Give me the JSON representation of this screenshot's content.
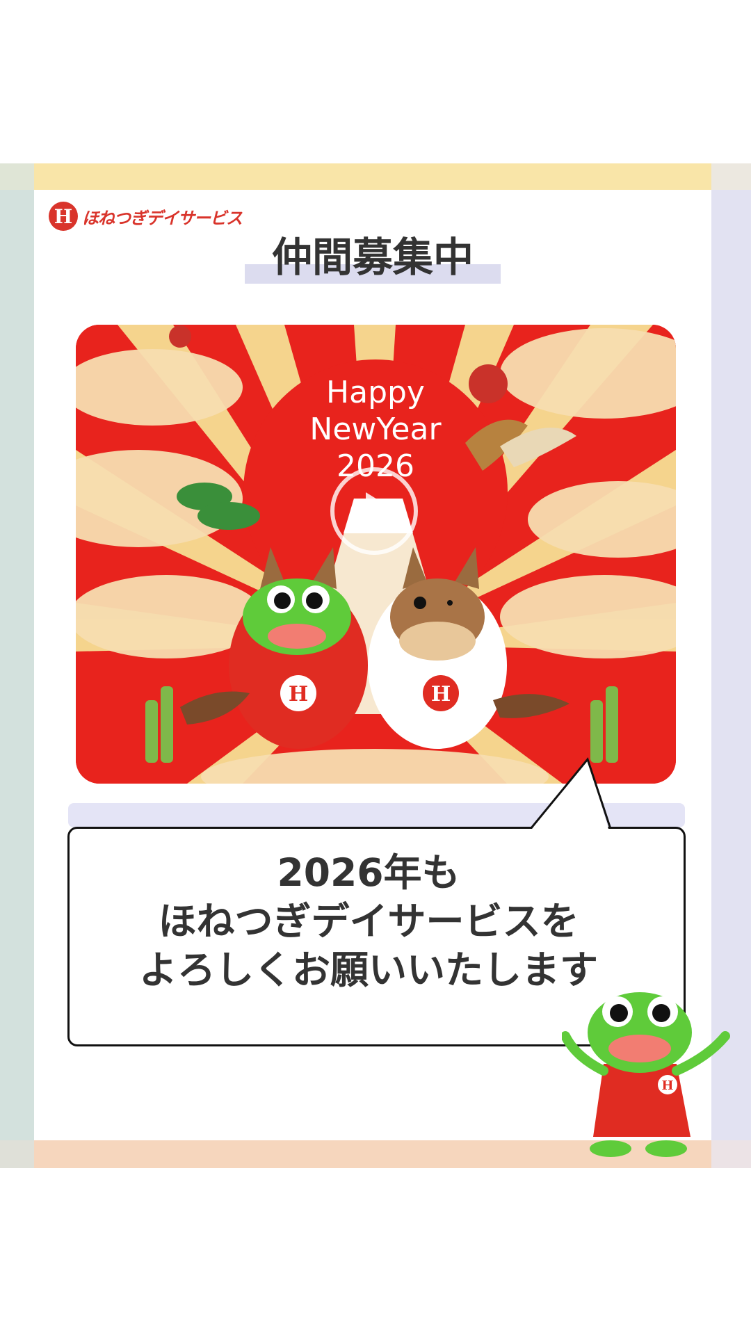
{
  "brand": {
    "logo_mark": "H",
    "name": "ほねつぎデイサービス",
    "color": "#d9342b"
  },
  "heading": "仲間募集中",
  "video": {
    "greeting_line1": "Happy",
    "greeting_line2": "NewYear",
    "greeting_year": "2026",
    "play_icon": "play-icon",
    "badge_letter": "H"
  },
  "message": {
    "line1": "2026年も",
    "line2": "ほねつぎデイサービスを",
    "line3": "よろしくお願いいたします"
  },
  "mascot_badge": "H",
  "colors": {
    "accent_red": "#e8231d",
    "top_strip": "#f9e5a8",
    "bottom_strip": "#f6d6bd",
    "left_strip": "#d3e1dd",
    "right_strip": "#e2e2f2"
  }
}
